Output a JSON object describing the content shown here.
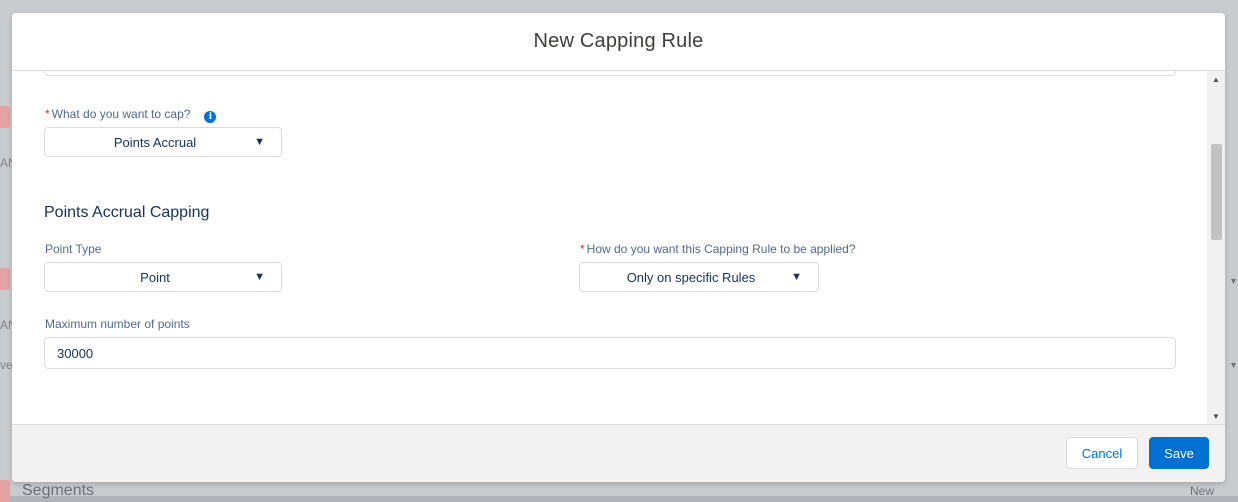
{
  "background": {
    "footer_text": "Segments",
    "new_label": "New",
    "side_labels": [
      "AN",
      "AN",
      "ve"
    ]
  },
  "modal": {
    "title": "New Capping Rule"
  },
  "form": {
    "cap_target": {
      "required_mark": "*",
      "label": "What do you want to cap?",
      "info_icon": "info-icon",
      "value": "Points Accrual",
      "caret": "▼"
    },
    "section_title": "Points Accrual Capping",
    "point_type": {
      "label": "Point Type",
      "value": "Point",
      "caret": "▼"
    },
    "applied_to": {
      "required_mark": "*",
      "label": "How do you want this Capping Rule to be applied?",
      "value": "Only on specific Rules",
      "caret": "▼"
    },
    "max_points": {
      "label": "Maximum number of points",
      "value": "30000"
    }
  },
  "scrollbar": {
    "up_arrow": "▲",
    "down_arrow": "▼"
  },
  "footer": {
    "cancel_label": "Cancel",
    "save_label": "Save"
  },
  "colors": {
    "brand_blue": "#0070d2",
    "required_red": "#c23934",
    "label": "#54698d",
    "text": "#16325c"
  }
}
